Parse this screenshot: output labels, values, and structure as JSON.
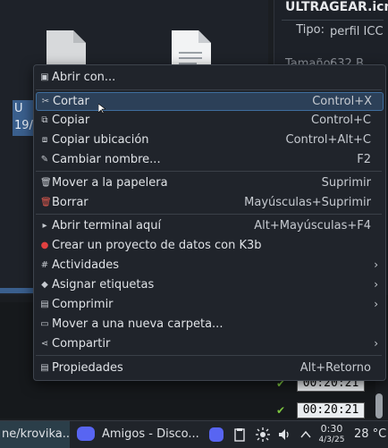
{
  "fileview": {
    "selected_item_line1": "U",
    "selected_item_line2": "19/"
  },
  "infopanel": {
    "title": "ULTRAGEAR.icm",
    "type_label": "Tipo:",
    "type_value": "perfil ICC",
    "size_label": "Tamaño:",
    "size_value": "632 B"
  },
  "context_menu": {
    "items": [
      {
        "icon": "open-with-icon",
        "label": "Abrir con...",
        "shortcut": ""
      },
      {
        "icon": "cut-icon",
        "label": "Cortar",
        "shortcut": "Control+X"
      },
      {
        "icon": "copy-icon",
        "label": "Copiar",
        "shortcut": "Control+C"
      },
      {
        "icon": "copy-location-icon",
        "label": "Copiar ubicación",
        "shortcut": "Control+Alt+C"
      },
      {
        "icon": "rename-icon",
        "label": "Cambiar nombre...",
        "shortcut": "F2"
      },
      {
        "icon": "trash-icon",
        "label": "Mover a la papelera",
        "shortcut": "Suprimir"
      },
      {
        "icon": "delete-icon",
        "label": "Borrar",
        "shortcut": "Mayúsculas+Suprimir"
      },
      {
        "icon": "terminal-icon",
        "label": "Abrir terminal aquí",
        "shortcut": "Alt+Mayúsculas+F4"
      },
      {
        "icon": "k3b-icon",
        "label": "Crear un proyecto de datos con K3b",
        "shortcut": ""
      },
      {
        "icon": "activities-icon",
        "label": "Actividades",
        "shortcut": ""
      },
      {
        "icon": "tag-icon",
        "label": "Asignar etiquetas",
        "shortcut": ""
      },
      {
        "icon": "compress-icon",
        "label": "Comprimir",
        "shortcut": ""
      },
      {
        "icon": "folder-move-icon",
        "label": "Mover a una nueva carpeta...",
        "shortcut": ""
      },
      {
        "icon": "share-icon",
        "label": "Compartir",
        "shortcut": ""
      },
      {
        "icon": "properties-icon",
        "label": "Propiedades",
        "shortcut": "Alt+Retorno"
      }
    ],
    "highlighted": "Cortar"
  },
  "terminal": {
    "times": [
      "00:20:21",
      "00:20:21"
    ]
  },
  "taskbar": {
    "terminal_task": "ne/krovika...",
    "discord_task": "Amigos - Disco...",
    "clock_time": "0:30",
    "clock_date": "4/3/25",
    "temperature": "28 °C"
  },
  "colors": {
    "accent": "#3a5f8d",
    "menu_bg": "#20242b",
    "highlight": "#2c4058",
    "discord": "#5865f2",
    "check": "#7cc53f"
  }
}
